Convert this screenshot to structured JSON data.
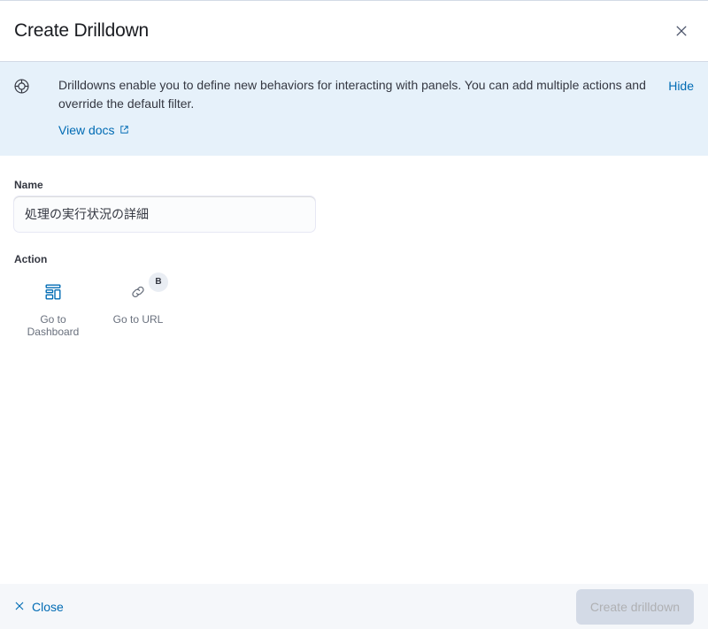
{
  "flyout": {
    "title": "Create Drilldown",
    "close_icon": "close-icon"
  },
  "callout": {
    "icon": "help-circle-icon",
    "text": "Drilldowns enable you to define new behaviors for interacting with panels. You can add multiple actions and override the default filter.",
    "docs_link_label": "View docs",
    "docs_link_icon": "external-link-icon",
    "hide_label": "Hide",
    "background_color": "#E6F1FA",
    "link_color": "#006BB4"
  },
  "form": {
    "name": {
      "label": "Name",
      "value": "処理の実行状況の詳細",
      "placeholder": ""
    },
    "action": {
      "label": "Action",
      "items": [
        {
          "label": "Go to Dashboard",
          "icon": "dashboard-icon",
          "icon_color": "#006BB4",
          "badge": ""
        },
        {
          "label": "Go to URL",
          "icon": "link-icon",
          "icon_color": "#69707D",
          "badge": "B"
        }
      ]
    }
  },
  "footer": {
    "close_label": "Close",
    "close_icon": "cross-icon",
    "submit_label": "Create drilldown",
    "submit_disabled": true
  }
}
